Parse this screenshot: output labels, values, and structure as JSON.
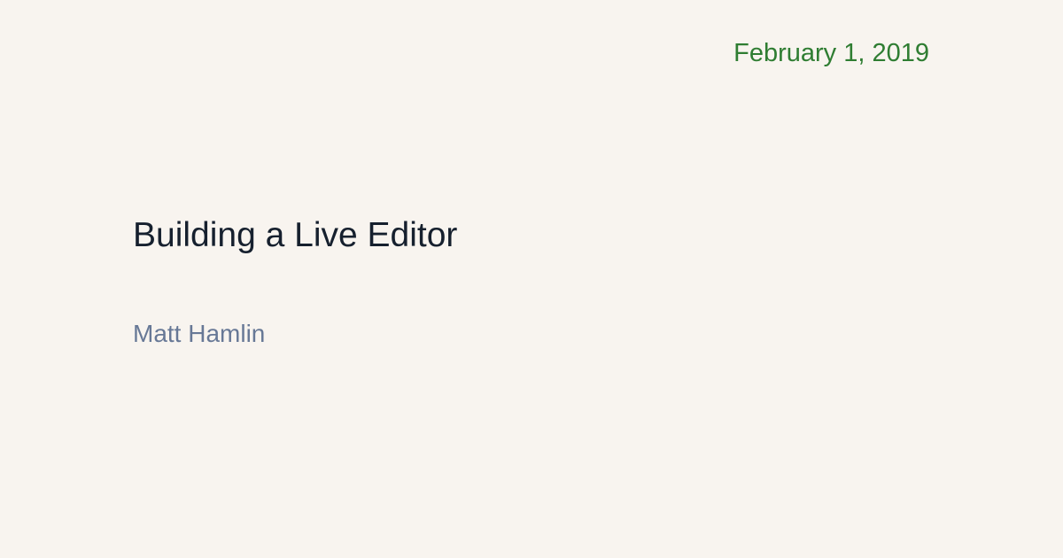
{
  "post": {
    "date": "February 1, 2019",
    "title": "Building a Live Editor",
    "author": "Matt Hamlin"
  },
  "colors": {
    "background": "#f8f4ef",
    "date": "#2f7d32",
    "title": "#16202e",
    "author": "#677896"
  }
}
